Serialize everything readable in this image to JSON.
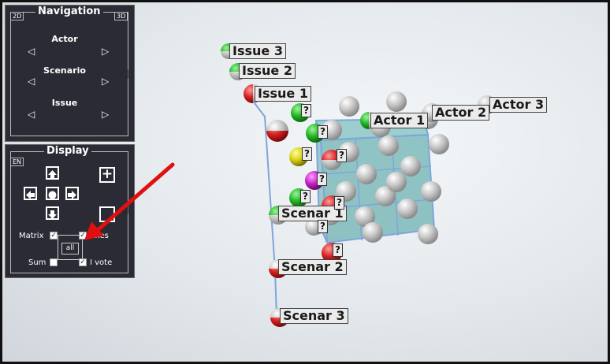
{
  "navigation": {
    "title": "Navigation",
    "tag_left": "2D",
    "tag_right": "3D",
    "rows": [
      {
        "label": "Actor"
      },
      {
        "label": "Scenario"
      },
      {
        "label": "Issue"
      }
    ],
    "arrow_left": "◁",
    "arrow_right": "▷",
    "collapse_arrow": "◁"
  },
  "display": {
    "title": "Display",
    "tag_language": "EN",
    "zoom_plus": "+",
    "all_label": "all",
    "checkboxes": {
      "matrix": {
        "label": "Matrix",
        "checked": true
      },
      "axes": {
        "label": "Axes",
        "checked": true
      },
      "sum": {
        "label": "Sum",
        "checked": false
      },
      "ivote": {
        "label": "I vote",
        "checked": true
      }
    },
    "check_mark": "✓"
  },
  "scene": {
    "issues": [
      "Issue 3",
      "Issue 2",
      "Issue 1"
    ],
    "actors": [
      "Actor 1",
      "Actor 2",
      "Actor 3"
    ],
    "scenarios": [
      "Scenar 1",
      "Scenar 2",
      "Scenar 3"
    ],
    "unknown_marker": "?",
    "colors": {
      "cube_fill": "#5aa8a8",
      "axis_line": "#7ea6dc",
      "ball_gray": "#b8b8b8",
      "ball_green": "#28b828",
      "ball_red": "#d42222",
      "ball_yellow": "#d8d020",
      "ball_magenta": "#c828c8",
      "pointer_arrow": "#e01010"
    }
  }
}
